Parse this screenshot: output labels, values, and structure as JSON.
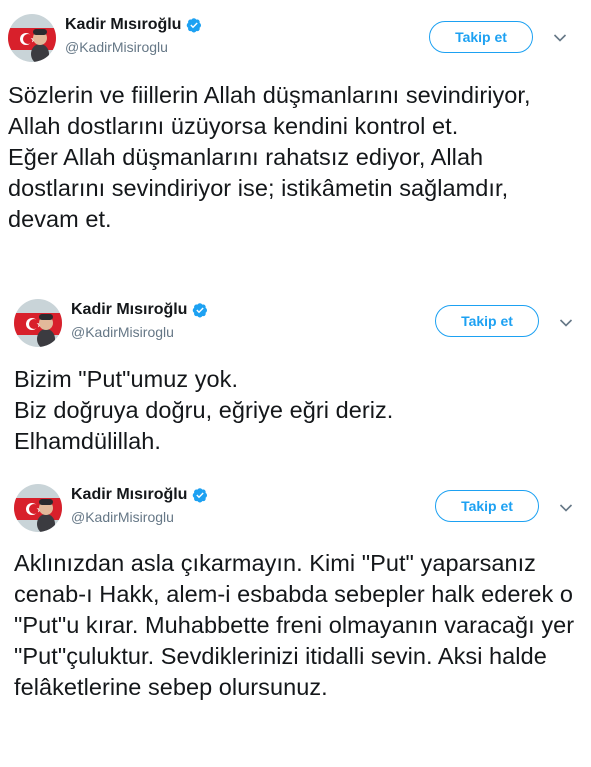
{
  "tweets": [
    {
      "author_name": "Kadir Mısıroğlu",
      "author_handle": "@KadirMisiroglu",
      "verified": true,
      "follow_label": "Takip et",
      "text": "Sözlerin ve fiillerin Allah düşmanlarını sevindiriyor, Allah dostlarını üzüyorsa kendini kontrol et.\nEğer Allah düşmanlarını rahatsız ediyor, Allah dostlarını sevindiriyor ise; istikâmetin sağlamdır, devam et."
    },
    {
      "author_name": "Kadir Mısıroğlu",
      "author_handle": "@KadirMisiroglu",
      "verified": true,
      "follow_label": "Takip et",
      "text": "Bizim \"Put\"umuz yok.\nBiz doğruya doğru, eğriye eğri deriz.\nElhamdülillah."
    },
    {
      "author_name": "Kadir Mısıroğlu",
      "author_handle": "@KadirMisiroglu",
      "verified": true,
      "follow_label": "Takip et",
      "text": "Aklınızdan asla çıkarmayın. Kimi \"Put\" yaparsanız cenab-ı Hakk, alem-i esbabda sebepler halk ederek o \"Put\"u kırar. Muhabbette freni olmayanın varacağı yer \"Put\"çuluktur. Sevdiklerinizi itidalli sevin. Aksi halde felâketlerine sebep olursunuz."
    }
  ],
  "colors": {
    "accent": "#1da1f2",
    "text": "#14171a",
    "secondary": "#657786"
  },
  "icons": {
    "verified": "verified-badge-icon",
    "caret": "chevron-down-icon",
    "avatar": "profile-avatar"
  }
}
